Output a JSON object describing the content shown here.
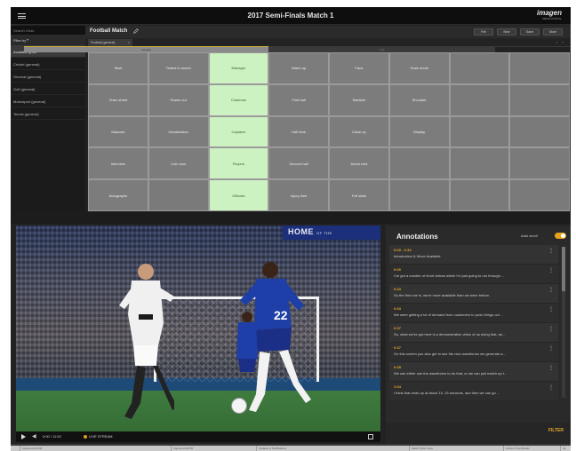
{
  "app": {
    "title": "2017 Semi-Finals Match 1",
    "logo": "imagen",
    "logo_sub": "MEDIA PORTAL"
  },
  "sidebar": {
    "search_placeholder": "Search Grids",
    "filter_label": "Filter by",
    "items": [
      {
        "label": "Available grids",
        "active": true
      },
      {
        "label": "Cricket (general)"
      },
      {
        "label": "General (general)"
      },
      {
        "label": "Golf (general)"
      },
      {
        "label": "Motorsport (general)"
      },
      {
        "label": "Tennis (general)"
      }
    ]
  },
  "workspace": {
    "title": "Football Match",
    "buttons": [
      "File",
      "New",
      "Save",
      "More"
    ],
    "tab_label": "Football (general)",
    "group_active": "General",
    "group_next": "Grid"
  },
  "grid": {
    "rows": [
      [
        {
          "label": "Start",
          "on": false
        },
        {
          "label": "Teams in tunnel",
          "on": false
        },
        {
          "label": "Manager",
          "on": true
        },
        {
          "label": "Warm up",
          "on": false
        },
        {
          "label": "Fans",
          "on": false
        },
        {
          "label": "Team shots",
          "on": false
        },
        {
          "label": "",
          "on": false
        },
        {
          "label": "",
          "on": false
        }
      ],
      [
        {
          "label": "Team sheet",
          "on": false
        },
        {
          "label": "Teams out",
          "on": false
        },
        {
          "label": "Chairman",
          "on": true
        },
        {
          "label": "First half",
          "on": false
        },
        {
          "label": "Stadium",
          "on": false
        },
        {
          "label": "Shoulder",
          "on": false
        },
        {
          "label": "",
          "on": false
        },
        {
          "label": "",
          "on": false
        }
      ],
      [
        {
          "label": "Mascots",
          "on": false
        },
        {
          "label": "Handshakes",
          "on": false
        },
        {
          "label": "Captains",
          "on": true
        },
        {
          "label": "Half time",
          "on": false
        },
        {
          "label": "Close up",
          "on": false
        },
        {
          "label": "Display",
          "on": false
        },
        {
          "label": "",
          "on": false
        },
        {
          "label": "",
          "on": false
        }
      ],
      [
        {
          "label": "Interview",
          "on": false
        },
        {
          "label": "Coin toss",
          "on": false
        },
        {
          "label": "Players",
          "on": true
        },
        {
          "label": "Second half",
          "on": false
        },
        {
          "label": "Aerial shot",
          "on": false
        },
        {
          "label": "",
          "on": false
        },
        {
          "label": "",
          "on": false
        },
        {
          "label": "",
          "on": false
        }
      ],
      [
        {
          "label": "Autographs",
          "on": false
        },
        {
          "label": "",
          "on": false
        },
        {
          "label": "Officials",
          "on": true
        },
        {
          "label": "Injury time",
          "on": false
        },
        {
          "label": "Full stats",
          "on": false
        },
        {
          "label": "",
          "on": false
        },
        {
          "label": "",
          "on": false
        },
        {
          "label": "",
          "on": false
        }
      ]
    ]
  },
  "video": {
    "banner": "HOME",
    "banner_sub": "OF THE",
    "time": "0:00 / 11:52",
    "live_label": "LIVE STREAM"
  },
  "annotations": {
    "title": "Annotations",
    "auto_scroll_label": "Auto scroll",
    "items": [
      {
        "time": "0:00 - 2:33",
        "text": "Introduction & Move Available"
      },
      {
        "time": "0:00",
        "text": "I've got a number of short videos which I'm just going to run through ..."
      },
      {
        "time": "0:33",
        "text": "So the first one is, we're more available than we were before."
      },
      {
        "time": "0:33",
        "text": "We were getting a lot of demand from customers to push things out ..."
      },
      {
        "time": "0:37",
        "text": "So, what we've got here is a demonstration video of us doing that, an..."
      },
      {
        "time": "0:37",
        "text": "On this screen you also get to see the nice waveforms we generate a..."
      },
      {
        "time": "0:45",
        "text": "We can either use the waveforms to do that, or we can pull match up t..."
      },
      {
        "time": "1:04",
        "text": "I think that ends up at about 10, 15 seconds, and then we can go ..."
      }
    ],
    "filter_label": "FILTER"
  },
  "bottom_tabs": [
    "Improved HOVR",
    "Improved HOVR",
    "Updates & Notifications",
    "Match Order View",
    "Custom Thumbnails",
    "Sp"
  ],
  "colors": {
    "accent": "#e3a52d",
    "cell_on": "#cdf2c2",
    "cell": "#7c7c7c"
  }
}
